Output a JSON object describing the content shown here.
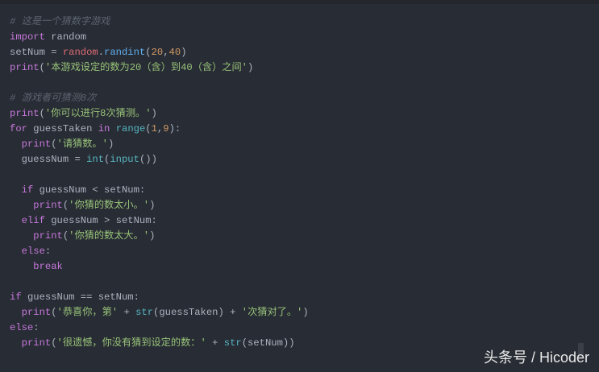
{
  "code_lines": [
    [
      [
        "cm",
        "# 这是一个猜数字游戏"
      ]
    ],
    [
      [
        "kw",
        "import"
      ],
      [
        "plain",
        " random"
      ]
    ],
    [
      [
        "plain",
        "setNum = "
      ],
      [
        "mod",
        "random"
      ],
      [
        "plain",
        "."
      ],
      [
        "fn",
        "randint"
      ],
      [
        "plain",
        "("
      ],
      [
        "num",
        "20"
      ],
      [
        "plain",
        ","
      ],
      [
        "num",
        "40"
      ],
      [
        "plain",
        ")"
      ]
    ],
    [
      [
        "kw",
        "print"
      ],
      [
        "plain",
        "("
      ],
      [
        "str",
        "'本游戏设定的数为20（含）到40（含）之间'"
      ],
      [
        "plain",
        ")"
      ]
    ],
    [],
    [
      [
        "cm",
        "# 游戏者可猜测8次"
      ]
    ],
    [
      [
        "kw",
        "print"
      ],
      [
        "plain",
        "("
      ],
      [
        "str",
        "'你可以进行8次猜测。'"
      ],
      [
        "plain",
        ")"
      ]
    ],
    [
      [
        "kw",
        "for"
      ],
      [
        "plain",
        " guessTaken "
      ],
      [
        "kw",
        "in"
      ],
      [
        "plain",
        " "
      ],
      [
        "bi",
        "range"
      ],
      [
        "plain",
        "("
      ],
      [
        "num",
        "1"
      ],
      [
        "plain",
        ","
      ],
      [
        "num",
        "9"
      ],
      [
        "plain",
        "):"
      ]
    ],
    [
      [
        "plain",
        "  "
      ],
      [
        "kw",
        "print"
      ],
      [
        "plain",
        "("
      ],
      [
        "str",
        "'请猜数。'"
      ],
      [
        "plain",
        ")"
      ]
    ],
    [
      [
        "plain",
        "  guessNum = "
      ],
      [
        "bi",
        "int"
      ],
      [
        "plain",
        "("
      ],
      [
        "bi",
        "input"
      ],
      [
        "plain",
        "())"
      ]
    ],
    [],
    [
      [
        "plain",
        "  "
      ],
      [
        "kw",
        "if"
      ],
      [
        "plain",
        " guessNum < setNum:"
      ]
    ],
    [
      [
        "plain",
        "    "
      ],
      [
        "kw",
        "print"
      ],
      [
        "plain",
        "("
      ],
      [
        "str",
        "'你猜的数太小。'"
      ],
      [
        "plain",
        ")"
      ]
    ],
    [
      [
        "plain",
        "  "
      ],
      [
        "kw",
        "elif"
      ],
      [
        "plain",
        " guessNum > setNum:"
      ]
    ],
    [
      [
        "plain",
        "    "
      ],
      [
        "kw",
        "print"
      ],
      [
        "plain",
        "("
      ],
      [
        "str",
        "'你猜的数太大。'"
      ],
      [
        "plain",
        ")"
      ]
    ],
    [
      [
        "plain",
        "  "
      ],
      [
        "kw",
        "else"
      ],
      [
        "plain",
        ":"
      ]
    ],
    [
      [
        "plain",
        "    "
      ],
      [
        "kw",
        "break"
      ]
    ],
    [],
    [
      [
        "kw",
        "if"
      ],
      [
        "plain",
        " guessNum == setNum:"
      ]
    ],
    [
      [
        "plain",
        "  "
      ],
      [
        "kw",
        "print"
      ],
      [
        "plain",
        "("
      ],
      [
        "str",
        "'恭喜你，第'"
      ],
      [
        "plain",
        " + "
      ],
      [
        "bi",
        "str"
      ],
      [
        "plain",
        "(guessTaken) + "
      ],
      [
        "str",
        "'次猜对了。'"
      ],
      [
        "plain",
        ")"
      ]
    ],
    [
      [
        "kw",
        "else"
      ],
      [
        "plain",
        ":"
      ]
    ],
    [
      [
        "plain",
        "  "
      ],
      [
        "kw",
        "print"
      ],
      [
        "plain",
        "("
      ],
      [
        "str",
        "'很遗憾，你没有猜到设定的数：'"
      ],
      [
        "plain",
        " + "
      ],
      [
        "bi",
        "str"
      ],
      [
        "plain",
        "(setNum))"
      ]
    ]
  ],
  "watermark": "头条号 / Hicoder"
}
